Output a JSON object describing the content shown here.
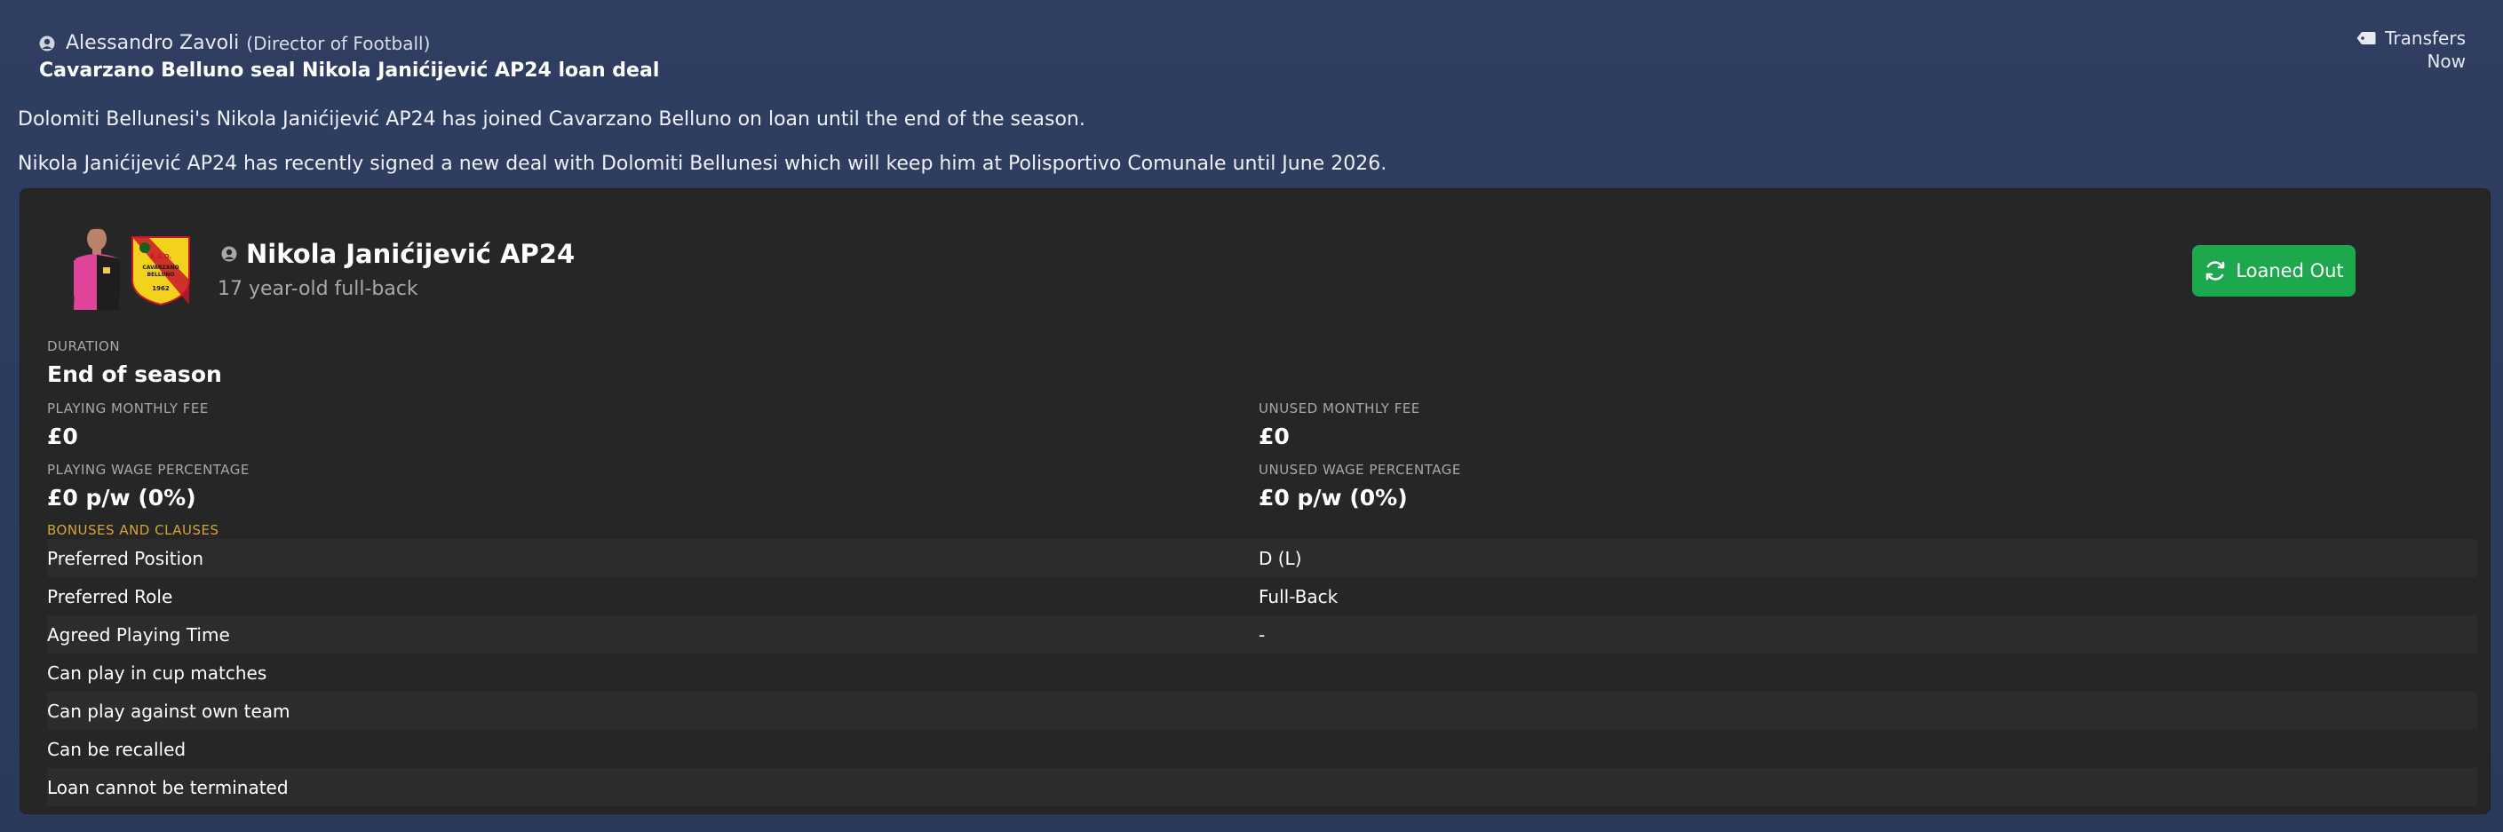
{
  "header": {
    "sender_name": "Alessandro Zavoli",
    "sender_role": "(Director of Football)",
    "headline": "Cavarzano Belluno seal Nikola Janićijević AP24 loan deal",
    "category": "Transfers",
    "time": "Now",
    "icons": {
      "person": "person-icon",
      "tag": "tag-icon"
    }
  },
  "body": {
    "paragraph1": "Dolomiti Bellunesi's Nikola Janićijević AP24 has joined Cavarzano Belluno on loan until the end of the season.",
    "paragraph2": "Nikola Janićijević AP24 has recently signed a new deal with Dolomiti Bellunesi which will keep him at Polisportivo Comunale until June 2026."
  },
  "card": {
    "player_name": "Nikola Janićijević AP24",
    "player_desc": "17 year-old full-back",
    "status_button": "Loaned Out",
    "duration_label": "DURATION",
    "duration_value": "End of season",
    "playing_fee_label": "PLAYING MONTHLY FEE",
    "playing_fee_value": "£0",
    "unused_fee_label": "UNUSED MONTHLY FEE",
    "unused_fee_value": "£0",
    "playing_wage_label": "PLAYING WAGE PERCENTAGE",
    "playing_wage_value": "£0 p/w (0%)",
    "unused_wage_label": "UNUSED WAGE PERCENTAGE",
    "unused_wage_value": "£0 p/w (0%)",
    "bonuses_label": "BONUSES AND CLAUSES",
    "clauses": [
      {
        "label": "Preferred Position",
        "value": "D (L)"
      },
      {
        "label": "Preferred Role",
        "value": "Full-Back"
      },
      {
        "label": "Agreed Playing Time",
        "value": "-"
      },
      {
        "label": "Can play in cup matches",
        "value": ""
      },
      {
        "label": "Can play against own team",
        "value": ""
      },
      {
        "label": "Can be recalled",
        "value": ""
      },
      {
        "label": "Loan cannot be terminated",
        "value": ""
      }
    ],
    "badge_text": {
      "top": "A.S.D.",
      "name": "CAVARZANO BELLUNO",
      "year": "1962"
    }
  },
  "colors": {
    "background": "#2e3d5f",
    "card": "#262626",
    "button": "#1ea84e",
    "accent_label": "#d4a537",
    "muted": "#a8a8a8"
  }
}
